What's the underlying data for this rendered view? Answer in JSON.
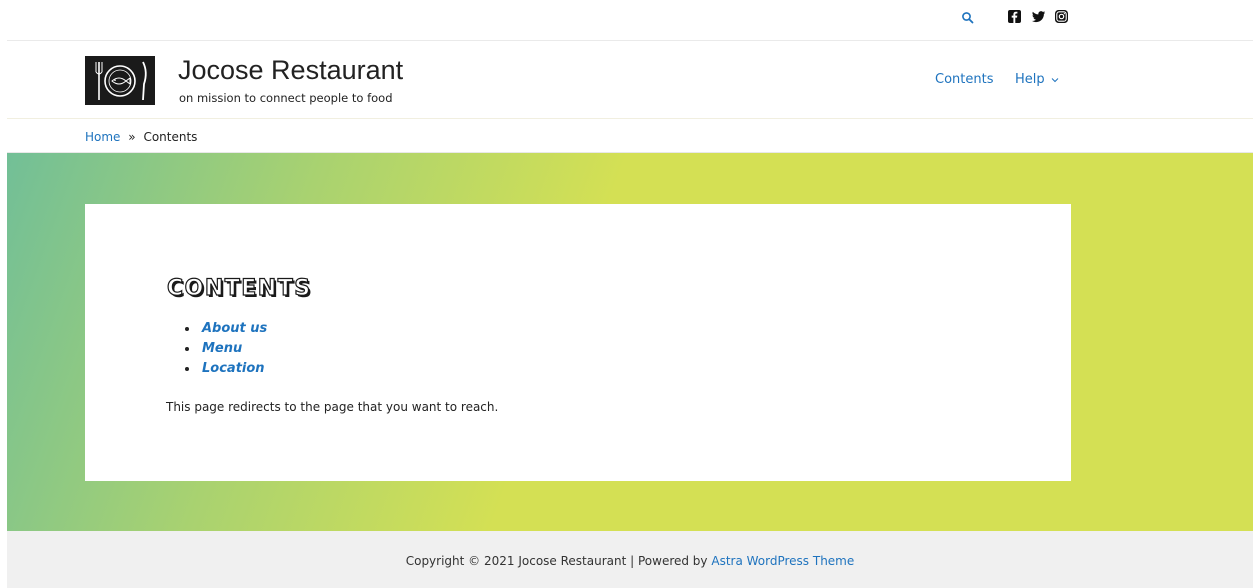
{
  "topbar": {
    "search_icon": "search-icon",
    "social": [
      {
        "name": "facebook",
        "icon": "facebook-icon"
      },
      {
        "name": "twitter",
        "icon": "twitter-icon"
      },
      {
        "name": "instagram",
        "icon": "instagram-icon"
      }
    ]
  },
  "header": {
    "logo_icon": "restaurant-logo-icon",
    "site_title": "Jocose Restaurant",
    "tagline": "on mission to connect people to food",
    "nav": [
      {
        "label": "Contents"
      },
      {
        "label": "Help",
        "has_dropdown": true
      }
    ]
  },
  "breadcrumb": {
    "home": "Home",
    "separator": "»",
    "current": "Contents"
  },
  "content": {
    "title": "Contents",
    "links": [
      "About us",
      "Menu",
      "Location"
    ],
    "text": "This page redirects to the page that you want to reach."
  },
  "footer": {
    "copyright": "Copyright © 2021 Jocose Restaurant | Powered by",
    "link": "Astra WordPress Theme"
  },
  "colors": {
    "link": "#1e73be",
    "gradient_start": "#72bf97",
    "gradient_end": "#d4e054",
    "footer_bg": "#f0f0f0"
  }
}
